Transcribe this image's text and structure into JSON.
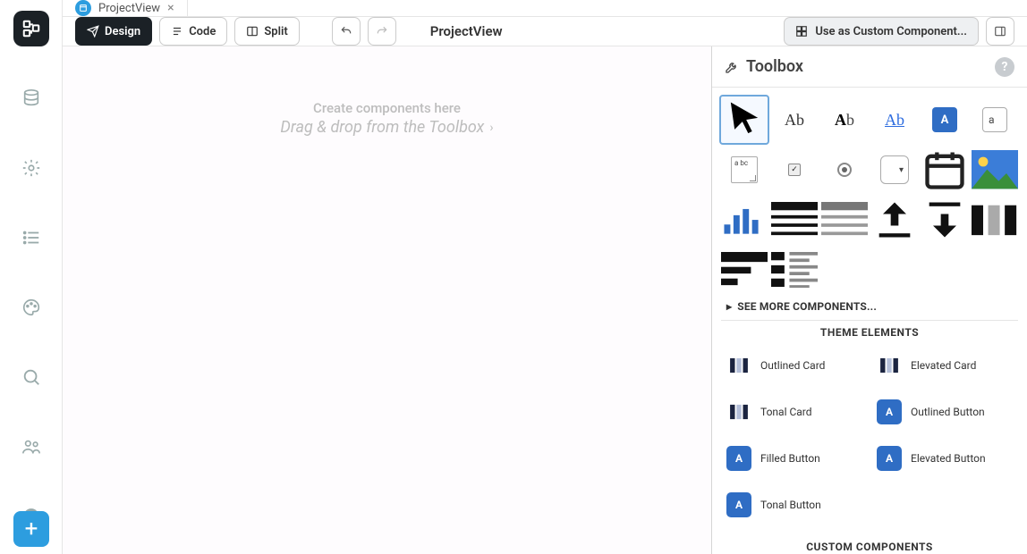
{
  "tab": {
    "title": "ProjectView"
  },
  "toolbar": {
    "design": "Design",
    "code": "Code",
    "split": "Split",
    "page_title": "ProjectView",
    "use_component": "Use as Custom Component..."
  },
  "canvas": {
    "line1": "Create components here",
    "line2": "Drag & drop from the Toolbox"
  },
  "toolbox": {
    "title": "Toolbox",
    "see_more": "SEE MORE COMPONENTS...",
    "minis": {
      "label": "Ab",
      "label_bold_a": "A",
      "label_bold_b": "b",
      "link": "Ab",
      "button": "A",
      "textbox": "a",
      "textarea": "a bc"
    },
    "sections": {
      "theme": "THEME ELEMENTS",
      "custom": "CUSTOM COMPONENTS"
    },
    "theme_items": [
      {
        "key": "outlined_card",
        "label": "Outlined Card",
        "kind": "card"
      },
      {
        "key": "elevated_card",
        "label": "Elevated Card",
        "kind": "card"
      },
      {
        "key": "tonal_card",
        "label": "Tonal Card",
        "kind": "card"
      },
      {
        "key": "outlined_button",
        "label": "Outlined Button",
        "kind": "button"
      },
      {
        "key": "filled_button",
        "label": "Filled Button",
        "kind": "button"
      },
      {
        "key": "elevated_button",
        "label": "Elevated Button",
        "kind": "button"
      },
      {
        "key": "tonal_button",
        "label": "Tonal Button",
        "kind": "button"
      }
    ]
  }
}
